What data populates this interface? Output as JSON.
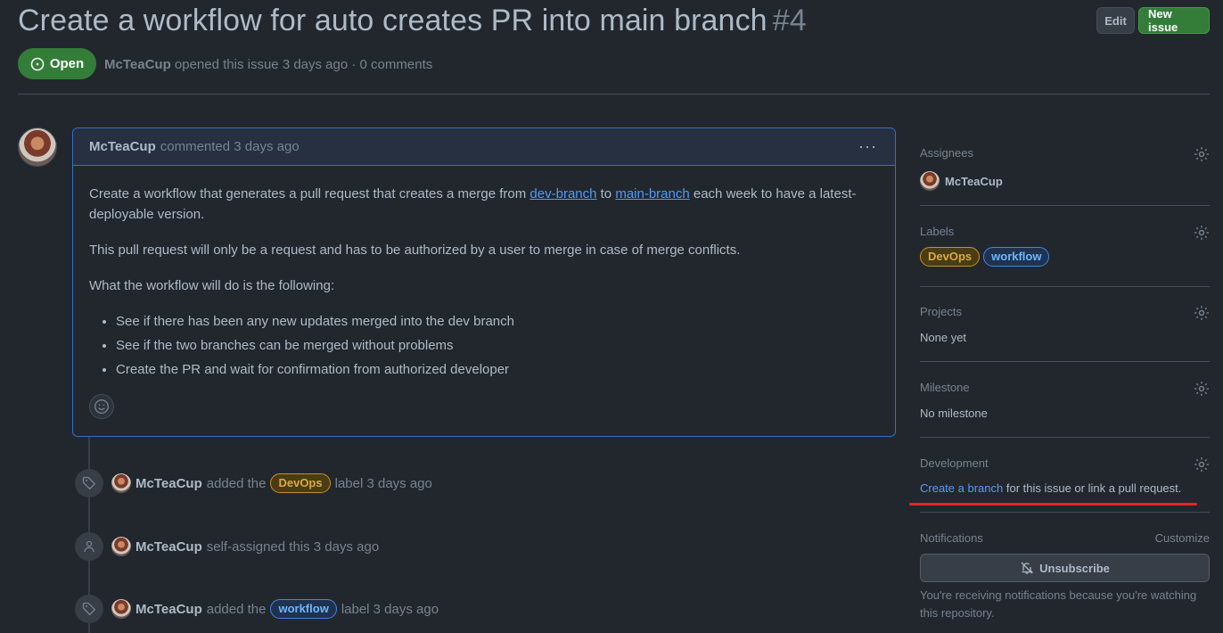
{
  "issue": {
    "title": "Create a workflow for auto creates PR into main branch",
    "number": "#4",
    "state": "Open",
    "author": "McTeaCup",
    "meta_rest": "opened this issue 3 days ago · 0 comments"
  },
  "header": {
    "edit_label": "Edit",
    "new_issue_label": "New issue"
  },
  "comment": {
    "author": "McTeaCup",
    "time": "commented 3 days ago",
    "menu": "···",
    "p1_before": "Create a workflow that generates a pull request that creates a merge from ",
    "p1_link1": "dev-branch",
    "p1_mid": " to ",
    "p1_link2": "main-branch",
    "p1_after": " each week to have a latest-deployable version.",
    "p2": "This pull request will only be a request and has to be authorized by a user to merge in case of merge conflicts.",
    "p3": "What the workflow will do is the following:",
    "list": [
      "See if there has been any new updates merged into the dev branch",
      "See if the two branches can be merged without problems",
      "Create the PR and wait for confirmation from authorized developer"
    ]
  },
  "timeline": [
    {
      "user": "McTeaCup",
      "pre": "added the",
      "label": "DevOps",
      "post": "label 3 days ago",
      "icon": "tag-icon"
    },
    {
      "user": "McTeaCup",
      "text": "self-assigned this 3 days ago",
      "icon": "person-icon"
    },
    {
      "user": "McTeaCup",
      "pre": "added the",
      "label": "workflow",
      "post": "label 3 days ago",
      "icon": "tag-icon"
    }
  ],
  "sidebar": {
    "assignees_title": "Assignees",
    "assignee": "McTeaCup",
    "labels_title": "Labels",
    "labels": [
      "DevOps",
      "workflow"
    ],
    "projects_title": "Projects",
    "projects_value": "None yet",
    "milestone_title": "Milestone",
    "milestone_value": "No milestone",
    "development_title": "Development",
    "dev_link": "Create a branch",
    "dev_rest": " for this issue or link a pull request.",
    "notifications_title": "Notifications",
    "customize": "Customize",
    "unsubscribe": "Unsubscribe",
    "notif_note": "You're receiving notifications because you're watching this repository."
  },
  "colors": {
    "open_green": "#347d39",
    "link_blue": "#539bf5",
    "devops_label": "#daaa3f",
    "workflow_label": "#6cb6ff",
    "annotation_red": "#e5252a"
  }
}
